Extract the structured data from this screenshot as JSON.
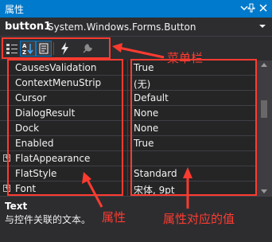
{
  "window": {
    "title": "属性"
  },
  "object": {
    "name": "button1",
    "type": "System.Windows.Forms.Button"
  },
  "toolbar": {
    "buttons": [
      {
        "icon": "categorized-icon"
      },
      {
        "icon": "alphabetical-icon"
      },
      {
        "icon": "properties-icon"
      },
      {
        "icon": "events-icon"
      },
      {
        "icon": "property-pages-icon"
      }
    ]
  },
  "properties": [
    {
      "name": "CausesValidation",
      "value": "True",
      "expandable": false
    },
    {
      "name": "ContextMenuStrip",
      "value": "(无)",
      "expandable": false
    },
    {
      "name": "Cursor",
      "value": "Default",
      "expandable": false
    },
    {
      "name": "DialogResult",
      "value": "None",
      "expandable": false
    },
    {
      "name": "Dock",
      "value": "None",
      "expandable": false
    },
    {
      "name": "Enabled",
      "value": "True",
      "expandable": false
    },
    {
      "name": "FlatAppearance",
      "value": "",
      "expandable": true
    },
    {
      "name": "FlatStyle",
      "value": "Standard",
      "expandable": false
    },
    {
      "name": "Font",
      "value": "宋体, 9pt",
      "expandable": true
    }
  ],
  "description": {
    "title": "Text",
    "text": "与控件关联的文本。"
  },
  "annotations": {
    "menubar": "菜单栏",
    "property": "属性",
    "property_value": "属性对应的值"
  },
  "colors": {
    "accent": "#007acc",
    "annotation": "#ff3b30",
    "background": "#252526"
  }
}
